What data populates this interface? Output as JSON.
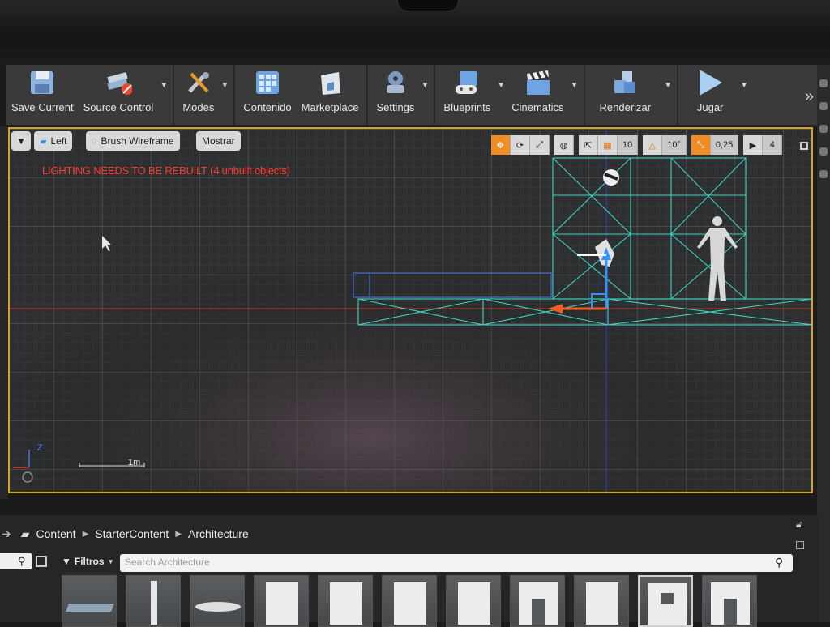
{
  "toolbar": {
    "buttons": [
      {
        "label": "Save Current",
        "icon": "floppy-disk-icon"
      },
      {
        "label": "Source Control",
        "icon": "source-control-icon"
      },
      {
        "label": "Modes",
        "icon": "modes-tools-icon"
      },
      {
        "label": "Contenido",
        "icon": "content-grid-icon"
      },
      {
        "label": "Marketplace",
        "icon": "marketplace-bag-icon"
      },
      {
        "label": "Settings",
        "icon": "settings-gears-icon"
      },
      {
        "label": "Blueprints",
        "icon": "blueprints-icon"
      },
      {
        "label": "Cinematics",
        "icon": "clapperboard-icon"
      },
      {
        "label": "Renderizar",
        "icon": "build-cubes-icon"
      },
      {
        "label": "Jugar",
        "icon": "play-icon"
      }
    ],
    "more": "»"
  },
  "viewport": {
    "view_label": "Left",
    "mode_label": "Brush Wireframe",
    "show_label": "Mostrar",
    "warning": "LIGHTING NEEDS TO BE REBUILT (4 unbuilt objects)",
    "grid_snap": "10",
    "rotation_snap": "10°",
    "scale_snap": "0,25",
    "camera_speed": "4",
    "scale_label": "1m",
    "axis_z": "Z"
  },
  "content_browser": {
    "breadcrumb": [
      "Content",
      "StarterContent",
      "Architecture"
    ],
    "filters_label": "Filtros",
    "search_placeholder": "Search Architecture",
    "thumbnail_count": 11
  },
  "colors": {
    "viewport_border": "#d6a321",
    "warning_text": "#ff3d2e",
    "wireframe": "#3ed2c2",
    "accent_orange": "#f08c22"
  }
}
